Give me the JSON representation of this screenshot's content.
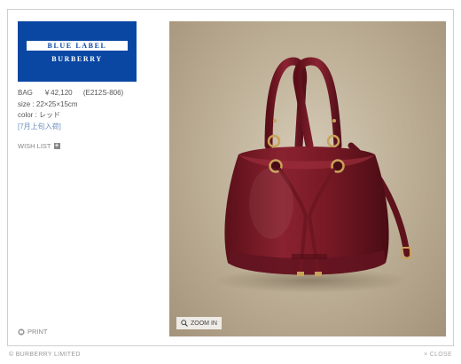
{
  "logo": {
    "line1": "BLUE LABEL",
    "line2": "BURBERRY"
  },
  "product": {
    "category": "BAG",
    "price": "￥42,120",
    "code": "(E212S-806)",
    "size": "size : 22×25×15cm",
    "color": "color : レッド",
    "availability": "[7月上旬入荷]"
  },
  "actions": {
    "wishlist": "WISH LIST",
    "print": "PRINT",
    "zoom": "ZOOM IN",
    "close": "× CLOSE"
  },
  "footer": {
    "copyright": "© BURBERRY LIMITED"
  },
  "colors": {
    "logo_bg": "#0a47a3",
    "bag_red": "#7a1a25",
    "backdrop": "#c0b299"
  }
}
